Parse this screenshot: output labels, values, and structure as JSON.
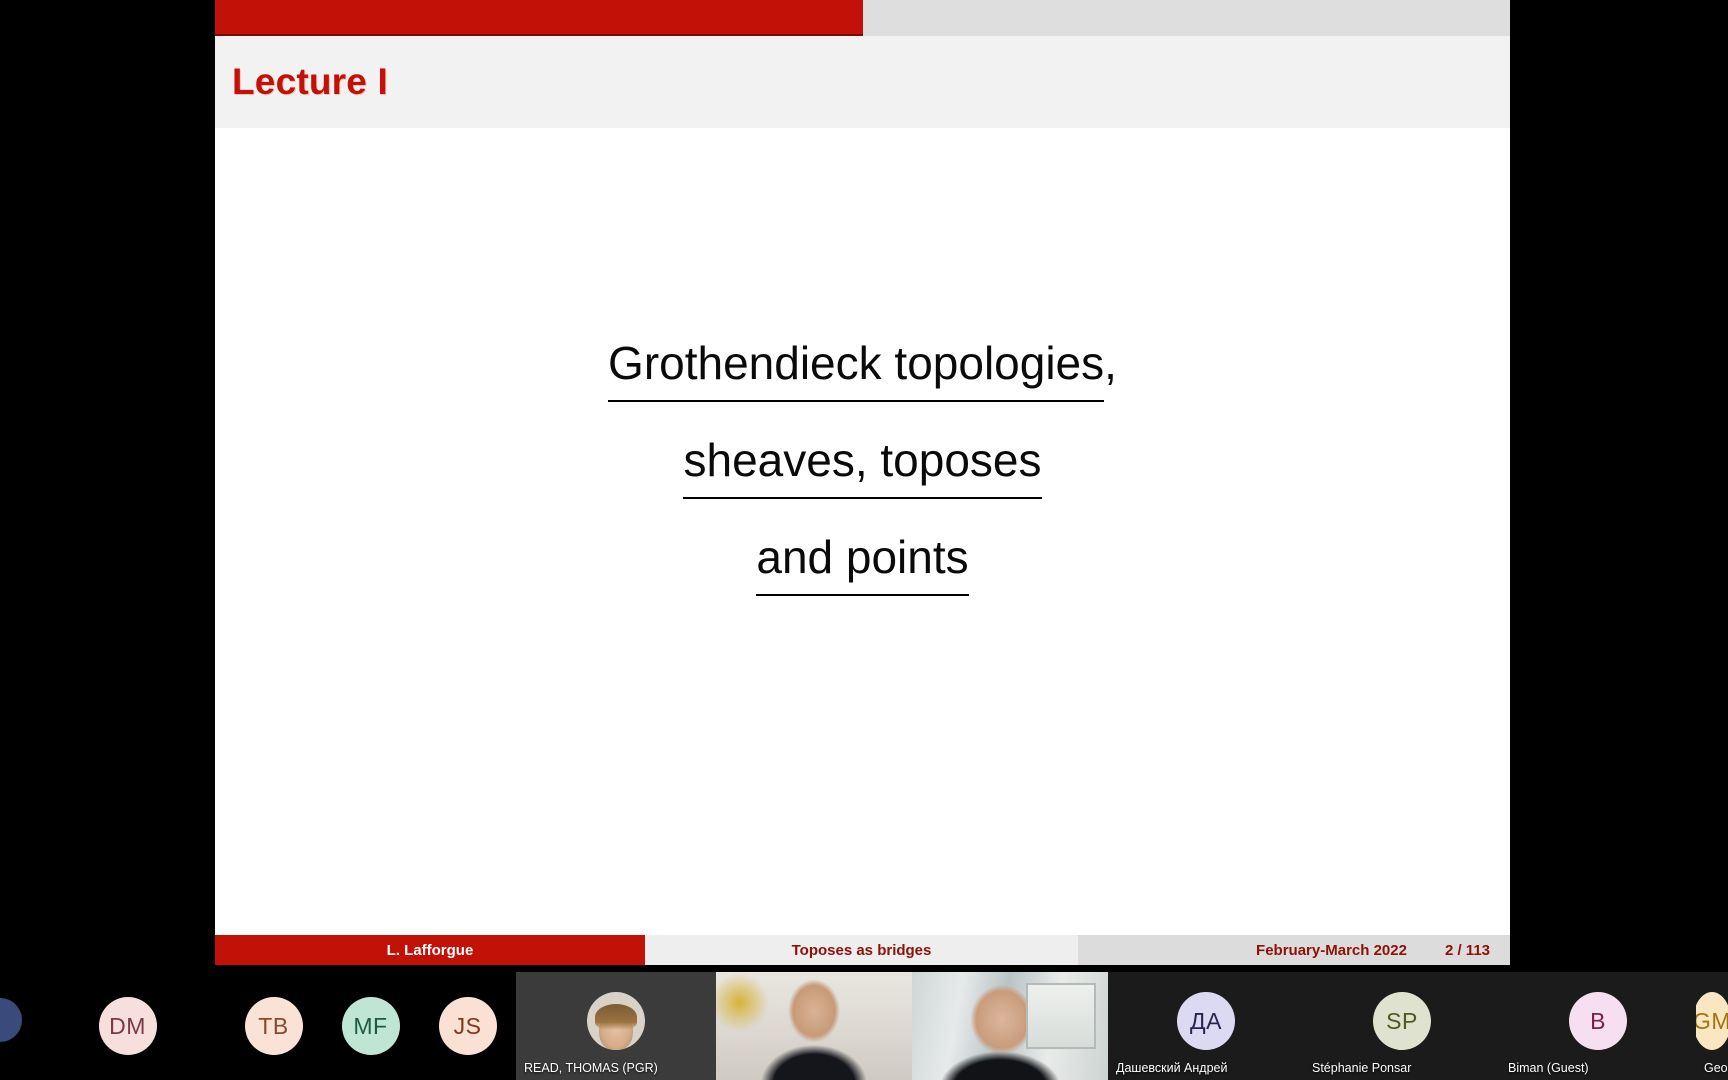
{
  "slide": {
    "title": "Lecture I",
    "nav": {
      "filled_label": "progress-filled",
      "empty_label": "progress-empty"
    },
    "body_lines": [
      {
        "underlined": "Grothendieck topologies",
        "trailing": ","
      },
      {
        "underlined": "sheaves, toposes",
        "trailing": ""
      },
      {
        "underlined": "and points",
        "trailing": ""
      }
    ],
    "footer": {
      "author": "L. Lafforgue",
      "talk": "Toposes as bridges",
      "date": "February-March 2022",
      "page": "2 / 113"
    }
  },
  "filmstrip": {
    "participants": [
      {
        "name": "",
        "initials": "",
        "kind": "edge",
        "bg": "#3a4a7a",
        "fg": "#ffffff"
      },
      {
        "name": "",
        "initials": "DM",
        "kind": "initials",
        "bg": "#f7dfdd",
        "fg": "#7a3b44"
      },
      {
        "name": "",
        "initials": "TB",
        "kind": "initials",
        "bg": "#fbe2d7",
        "fg": "#8a4a2a"
      },
      {
        "name": "",
        "initials": "MF",
        "kind": "initials",
        "bg": "#bfe6d4",
        "fg": "#1d5a43"
      },
      {
        "name": "",
        "initials": "JS",
        "kind": "initials",
        "bg": "#fbe0d4",
        "fg": "#7e3a20"
      },
      {
        "name": "READ, THOMAS (PGR)",
        "initials": "",
        "kind": "photo",
        "bg": "#3b3b3b",
        "fg": "#ffffff"
      },
      {
        "name": "",
        "initials": "",
        "kind": "camera-a",
        "bg": "#dcd8d1",
        "fg": "#ffffff"
      },
      {
        "name": "",
        "initials": "",
        "kind": "camera-b",
        "bg": "#d5dadb",
        "fg": "#ffffff"
      },
      {
        "name": "Дашевский Андрей",
        "initials": "ДА",
        "kind": "initials",
        "bg": "#dcdaf2",
        "fg": "#2a2550"
      },
      {
        "name": "Stéphanie Ponsar",
        "initials": "SP",
        "kind": "initials",
        "bg": "#dfe2cf",
        "fg": "#4e5a22"
      },
      {
        "name": "Biman (Guest)",
        "initials": "B",
        "kind": "initials",
        "bg": "#f6dff0",
        "fg": "#7a1f45"
      },
      {
        "name": "George McNinch (",
        "initials": "GM",
        "kind": "initials",
        "bg": "#fbe6c2",
        "fg": "#a07410"
      }
    ]
  },
  "colors": {
    "beamer_red": "#c21207",
    "beamer_red_dark": "#8e1107",
    "title_band": "#f2f2f2",
    "nav_empty": "#dedede",
    "footer_mid": "#efeeee",
    "footer_right": "#dcdcdc",
    "strip_bg": "#000000"
  }
}
